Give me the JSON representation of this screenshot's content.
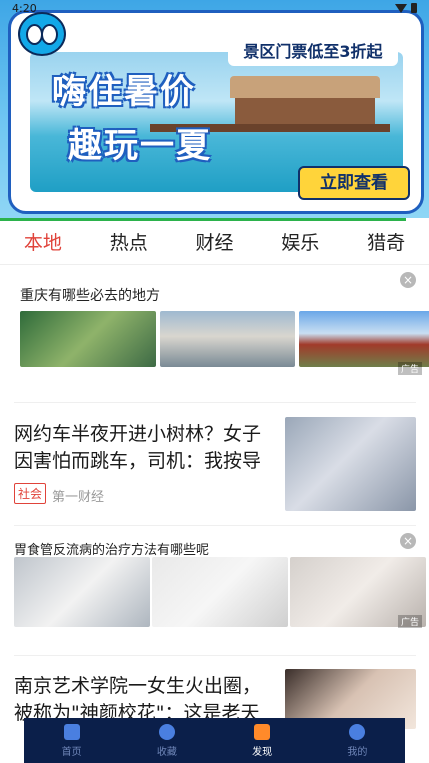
{
  "status_bar": {
    "time": "4:20"
  },
  "banner": {
    "headline_line1": "嗨住暑价",
    "headline_line2": "趣玩一夏",
    "subtitle": "景区门票低至3折起",
    "cta": "立即查看"
  },
  "tabs": [
    {
      "label": "本地",
      "active": true
    },
    {
      "label": "热点",
      "active": false
    },
    {
      "label": "财经",
      "active": false
    },
    {
      "label": "娱乐",
      "active": false
    },
    {
      "label": "猎奇",
      "active": false
    }
  ],
  "feed": {
    "ad1": {
      "title": "重庆有哪些必去的地方",
      "tag": "广告"
    },
    "news1": {
      "title_line1": "网约车半夜开进小树林？女子",
      "title_line2": "因害怕而跳车，司机：我按导",
      "badge": "社会",
      "source": "第一财经"
    },
    "ad2": {
      "title": "胃食管反流病的治疗方法有哪些呢",
      "tag": "广告"
    },
    "news2": {
      "title_line1": "南京艺术学院一女生火出圈，",
      "title_line2": "被称为\"神颜校花\"：这是老天"
    }
  },
  "bottom_nav": [
    {
      "label": "首页",
      "icon": "home-icon",
      "active": false
    },
    {
      "label": "收藏",
      "icon": "heart-icon",
      "active": false
    },
    {
      "label": "发现",
      "icon": "bookmark-icon",
      "active": true
    },
    {
      "label": "我的",
      "icon": "person-icon",
      "active": false
    }
  ],
  "colors": {
    "accent": "#e0433a",
    "nav_bg": "#0b1f4a",
    "active_nav": "#ff8a2a",
    "divider_green": "#2bb24c"
  }
}
